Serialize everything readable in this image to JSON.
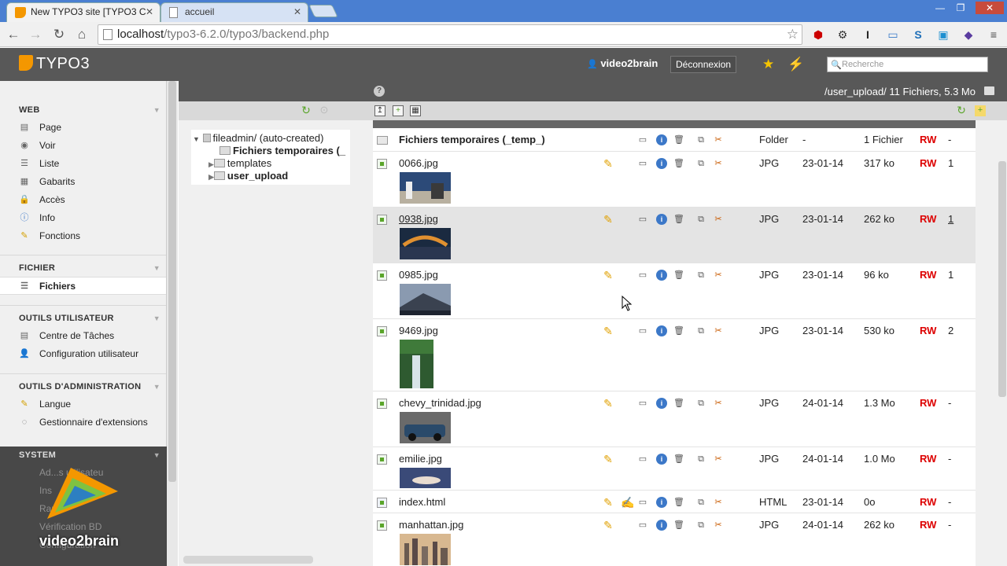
{
  "browser": {
    "tabs": [
      {
        "title": "New TYPO3 site [TYPO3 C",
        "close": "✕"
      },
      {
        "title": "accueil",
        "close": "✕"
      }
    ],
    "url_host": "localhost",
    "url_path": "/typo3-6.2.0/typo3/backend.php"
  },
  "topbar": {
    "logo": "TYPO3",
    "user": "video2brain",
    "logout": "Déconnexion",
    "search_placeholder": "Recherche"
  },
  "modmenu": {
    "sections": [
      {
        "title": "WEB",
        "items": [
          "Page",
          "Voir",
          "Liste",
          "Gabarits",
          "Accès",
          "Info",
          "Fonctions"
        ]
      },
      {
        "title": "FICHIER",
        "items": [
          "Fichiers"
        ]
      },
      {
        "title": "OUTILS UTILISATEUR",
        "items": [
          "Centre de Tâches",
          "Configuration utilisateur"
        ]
      },
      {
        "title": "OUTILS D'ADMINISTRATION",
        "items": [
          "Langue",
          "Gestionnaire d'extensions"
        ]
      },
      {
        "title": "SYSTEM",
        "items": [
          "Ad...s utilisateu",
          "Ins",
          "Rap",
          "Vérification BD",
          "Configuration"
        ]
      }
    ],
    "watermark": "video2brain"
  },
  "docheader": {
    "help": "?",
    "path": "/user_upload/ 11 Fichiers, 5.3 Mo"
  },
  "tree": {
    "root": "fileadmin/ (auto-created)",
    "children": [
      "Fichiers temporaires (_",
      "templates",
      "user_upload"
    ]
  },
  "filelist": {
    "rows": [
      {
        "name": "Fichiers temporaires (_temp_)",
        "type": "Folder",
        "date": "-",
        "size": "1 Fichier",
        "rw": "RW",
        "ref": "-"
      },
      {
        "name": "0066.jpg",
        "type": "JPG",
        "date": "23-01-14",
        "size": "317 ko",
        "rw": "RW",
        "ref": "1"
      },
      {
        "name": "0938.jpg",
        "type": "JPG",
        "date": "23-01-14",
        "size": "262 ko",
        "rw": "RW",
        "ref": "1"
      },
      {
        "name": "0985.jpg",
        "type": "JPG",
        "date": "23-01-14",
        "size": "96 ko",
        "rw": "RW",
        "ref": "1"
      },
      {
        "name": "9469.jpg",
        "type": "JPG",
        "date": "23-01-14",
        "size": "530 ko",
        "rw": "RW",
        "ref": "2"
      },
      {
        "name": "chevy_trinidad.jpg",
        "type": "JPG",
        "date": "24-01-14",
        "size": "1.3 Mo",
        "rw": "RW",
        "ref": "-"
      },
      {
        "name": "emilie.jpg",
        "type": "JPG",
        "date": "24-01-14",
        "size": "1.0 Mo",
        "rw": "RW",
        "ref": "-"
      },
      {
        "name": "index.html",
        "type": "HTML",
        "date": "23-01-14",
        "size": "0o",
        "rw": "RW",
        "ref": "-"
      },
      {
        "name": "manhattan.jpg",
        "type": "JPG",
        "date": "24-01-14",
        "size": "262 ko",
        "rw": "RW",
        "ref": "-"
      }
    ]
  },
  "colors": {
    "accent": "#f49700",
    "rw": "#dd0000",
    "chrome_blue": "#4a7fd1"
  }
}
